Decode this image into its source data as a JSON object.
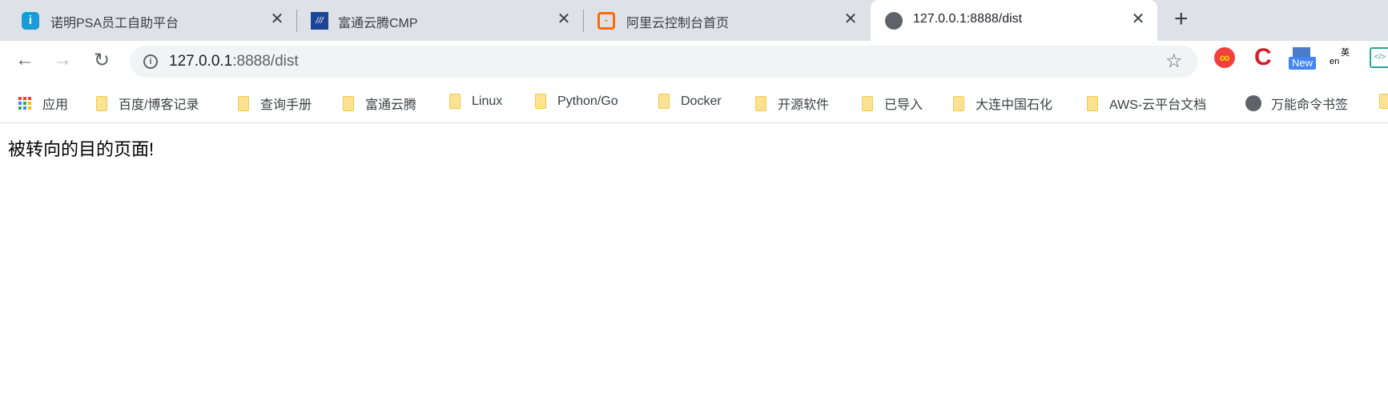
{
  "tabs": [
    {
      "title": "诺明PSA员工自助平台",
      "icon": "info-app-icon",
      "close": "✕"
    },
    {
      "title": "富通云腾CMP",
      "icon": "cmp-logo-icon",
      "close": "✕"
    },
    {
      "title": "阿里云控制台首页",
      "icon": "aliyun-logo-icon",
      "close": "✕"
    },
    {
      "title": "127.0.0.1:8888/dist",
      "icon": "globe-icon",
      "close": "✕",
      "active": true
    }
  ],
  "new_tab": "+",
  "address": {
    "host": "127.0.0.1",
    "rest": ":8888/dist"
  },
  "extensions": {
    "new_badge": "New",
    "translate_label": "en",
    "translate_zh": "英"
  },
  "bookmarks": [
    {
      "label": "应用",
      "icon": "apps-grid-icon"
    },
    {
      "label": "百度/博客记录",
      "icon": "folder-icon"
    },
    {
      "label": "查询手册",
      "icon": "folder-icon"
    },
    {
      "label": "富通云腾",
      "icon": "folder-icon"
    },
    {
      "label": "Linux",
      "icon": "folder-icon"
    },
    {
      "label": "Python/Go",
      "icon": "folder-icon"
    },
    {
      "label": "Docker",
      "icon": "folder-icon"
    },
    {
      "label": "开源软件",
      "icon": "folder-icon"
    },
    {
      "label": "已导入",
      "icon": "folder-icon"
    },
    {
      "label": "大连中国石化",
      "icon": "folder-icon"
    },
    {
      "label": "AWS-云平台文档",
      "icon": "folder-icon"
    },
    {
      "label": "万能命令书签",
      "icon": "globe-icon"
    }
  ],
  "page": {
    "text": "被转向的目的页面!"
  }
}
